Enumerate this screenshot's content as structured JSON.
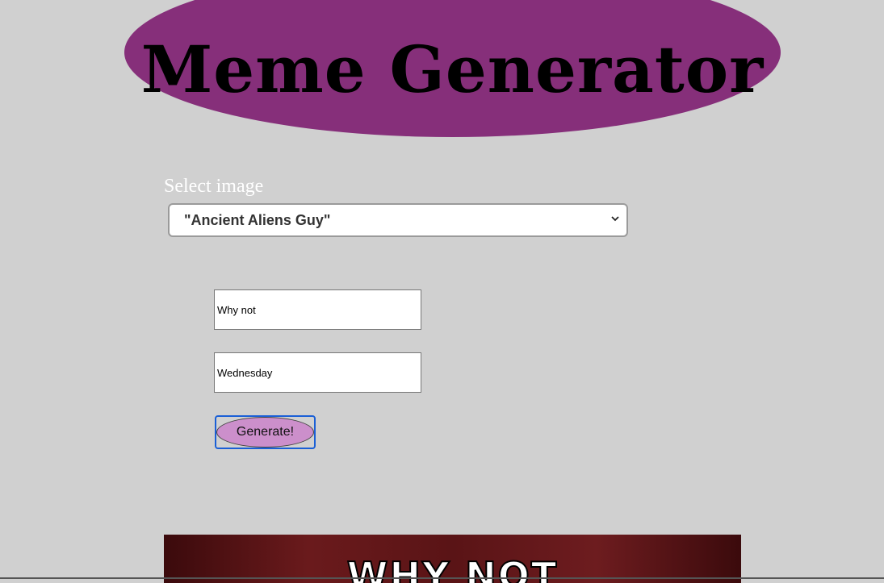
{
  "header": {
    "title": "Meme Generator",
    "background_color": "#862f7a"
  },
  "form": {
    "select_label": "Select image",
    "selected_image": "\"Ancient Aliens Guy\"",
    "top_text_value": "Why not",
    "bottom_text_value": "Wednesday",
    "generate_label": "Generate!",
    "button_color": "#cc8fcb"
  },
  "meme": {
    "top_caption": "WHY NOT"
  }
}
